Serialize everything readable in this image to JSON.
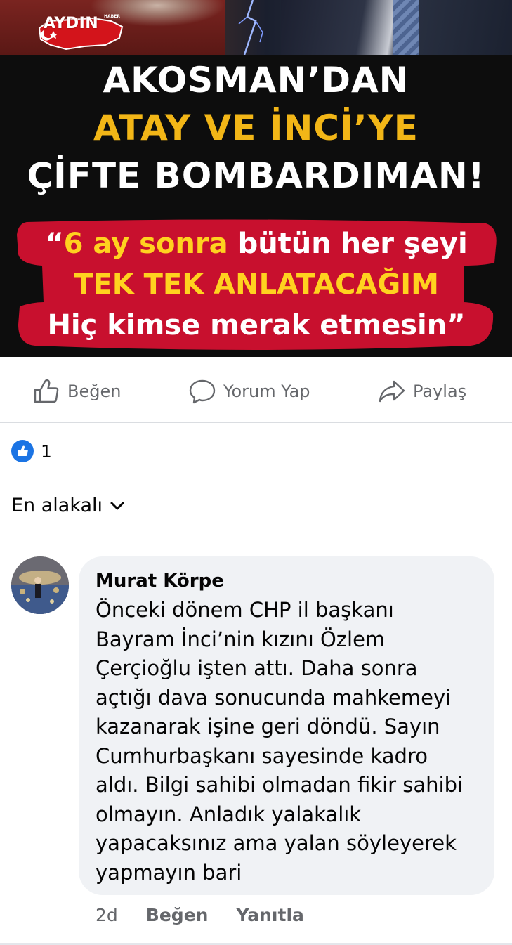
{
  "post_image": {
    "logo_text": "AYDIN",
    "logo_sub": "HABER",
    "headline": {
      "line1": "AKOSMAN’DAN",
      "line2": "ATAY VE İNCİ’YE",
      "line3": "ÇİFTE BOMBARDIMAN!"
    },
    "quote": {
      "open_quote": "“",
      "line1_yellow": "6 ay sonra",
      "line1_white": " bütün her şeyi",
      "line2": "TEK TEK ANLATACAĞIM",
      "line3": "Hiç kimse merak etmesin",
      "close_quote": "”"
    }
  },
  "actions": {
    "like_label": "Beğen",
    "comment_label": "Yorum Yap",
    "share_label": "Paylaş"
  },
  "reactions": {
    "count": "1",
    "icon": "thumbs-up"
  },
  "sort": {
    "label": "En alakalı"
  },
  "comment": {
    "author": "Murat Körpe",
    "text": "Önceki dönem CHP il başkanı\nBayram İnci’nin kızını Özlem\nÇerçioğlu işten attı. Daha sonra\naçtığı dava sonucunda mahkemeyi\nkazanarak işine geri döndü. Sayın\nCumhurbaşkanı sayesinde kadro\naldı. Bilgi sahibi olmadan fikir sahibi\nolmayın. Anladık yalakalık\nyapacaksınız ama yalan söyleyerek\nyapmayın bari",
    "time": "2d",
    "like_label": "Beğen",
    "reply_label": "Yanıtla"
  },
  "colors": {
    "brand_blue": "#1b74e4",
    "headline_yellow": "#f2b617",
    "quote_red": "#c8102e",
    "muted_text": "#65676b",
    "bubble_bg": "#f0f2f5"
  }
}
